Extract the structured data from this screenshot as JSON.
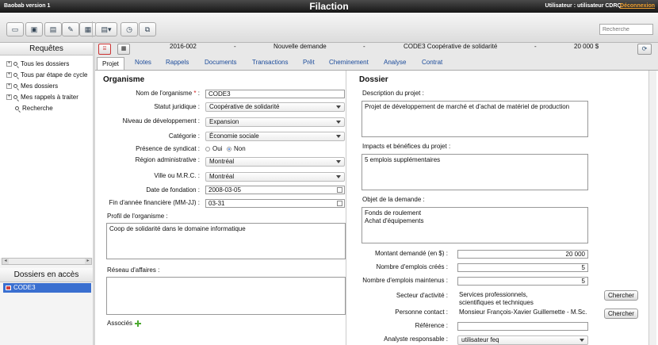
{
  "titlebar": {
    "version": "Baobab version 1",
    "app_title": "Filaction",
    "user": "Utilisateur : utilisateur CDRQ",
    "logout": "Déconnexion"
  },
  "toolbar": {
    "search_placeholder": "Recherche"
  },
  "sidebar": {
    "requests_title": "Requêtes",
    "items": [
      {
        "label": "Tous les dossiers",
        "expandable": true
      },
      {
        "label": "Tous par étape de cycle",
        "expandable": true
      },
      {
        "label": "Mes dossiers",
        "expandable": true
      },
      {
        "label": "Mes rappels à traiter",
        "expandable": true
      },
      {
        "label": "Recherche",
        "expandable": false
      }
    ],
    "access_title": "Dossiers en accès",
    "access_items": [
      "CODE3"
    ]
  },
  "header": {
    "number": "2016-002",
    "sep1": "-",
    "status": "Nouvelle demande",
    "sep2": "-",
    "org": "CODE3 Coopérative de solidarité",
    "sep3": "-",
    "amount": "20 000 $"
  },
  "tabs": [
    "Projet",
    "Notes",
    "Rappels",
    "Documents",
    "Transactions",
    "Prêt",
    "Cheminement",
    "Analyse",
    "Contrat"
  ],
  "organisme": {
    "title": "Organisme",
    "nom_label": "Nom de l'organisme",
    "required_mark": "*",
    "nom_colon": ":",
    "nom_value": "CODE3",
    "statut_label": "Statut juridique :",
    "statut_value": "Coopérative de solidarité",
    "niveau_label": "Niveau de développement :",
    "niveau_value": "Expansion",
    "categorie_label": "Catégorie :",
    "categorie_value": "Économie sociale",
    "syndicat_label": "Présence de syndicat :",
    "syndicat_oui": "Oui",
    "syndicat_non": "Non",
    "region_label": "Région administrative :",
    "region_value": "Montréal",
    "ville_label": "Ville ou M.R.C. :",
    "ville_value": "Montréal",
    "fondation_label": "Date de fondation :",
    "fondation_value": "2008-03-05",
    "fin_label": "Fin d'année financière (MM-JJ) :",
    "fin_value": "03-31",
    "profil_label": "Profil de l'organisme :",
    "profil_value": "Coop de solidarité dans le domaine informatique",
    "reseau_label": "Réseau d'affaires :",
    "reseau_value": "",
    "associes_label": "Associés"
  },
  "dossier": {
    "title": "Dossier",
    "description_label": "Description du projet :",
    "description_value": "Projet de développement de marché et d'achat de matériel de production",
    "impacts_label": "Impacts et bénéfices du projet :",
    "impacts_value": "5 emplois supplémentaires",
    "objet_label": "Objet de la demande :",
    "objet_line1": "Fonds de roulement",
    "objet_line2": "Achat d'équipements",
    "montant_label": "Montant demandé (en $) :",
    "montant_value": "20 000",
    "crees_label": "Nombre d'emplois créés :",
    "crees_value": "5",
    "maintenus_label": "Nombre d'emplois maintenus :",
    "maintenus_value": "5",
    "secteur_label": "Secteur d'activité :",
    "secteur_line1": "Services professionnels,",
    "secteur_line2": "scientifiques et techniques",
    "contact_label": "Personne contact :",
    "contact_value": "Monsieur François-Xavier Guillemette - M.Sc.",
    "reference_label": "Référence :",
    "reference_value": "",
    "analyste_label": "Analyste responsable :",
    "analyste_value": "utilisateur feq",
    "chercher_label": "Chercher"
  }
}
